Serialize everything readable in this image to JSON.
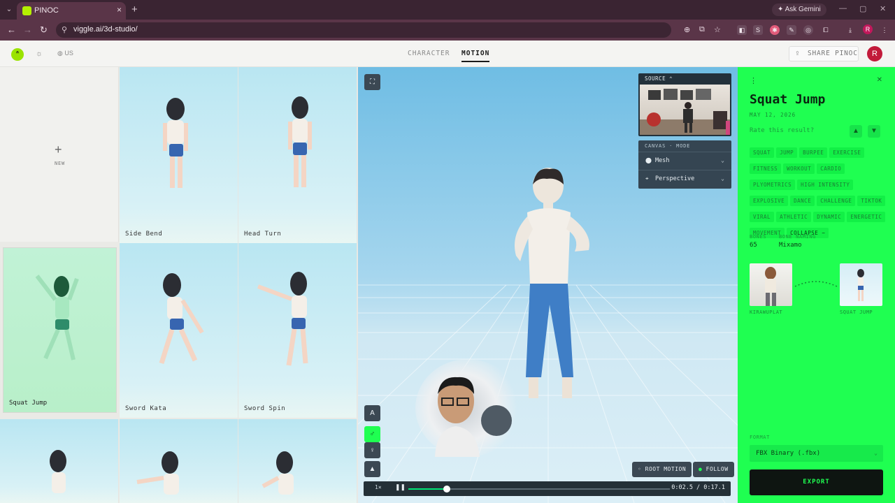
{
  "browser": {
    "tab_title": "PINOC",
    "url": "viggle.ai/3d-studio/",
    "ask_gemini": "Ask Gemini",
    "profile_initial": "R"
  },
  "header": {
    "region": "US",
    "tabs": [
      "CHARACTER",
      "MOTION"
    ],
    "active_tab": "MOTION",
    "share_label": "SHARE PINOC",
    "avatar_initial": "R",
    "logo_color": "#9be300"
  },
  "library": {
    "new_label": "NEW",
    "cards": [
      "Side Bend",
      "Head Turn",
      "Squat Jump",
      "Sword Kata",
      "Sword Spin"
    ],
    "selected": "Squat Jump"
  },
  "viewport": {
    "source_label": "SOURCE",
    "canvas_mode_label": "CANVAS · MODE",
    "render_mode": "Mesh",
    "camera_mode": "Perspective",
    "side_button": "A",
    "root_motion": "ROOT MOTION",
    "follow": "FOLLOW",
    "speed": "1×",
    "time": "0:02.5 / 0:17.1",
    "progress": 0.146
  },
  "panel": {
    "title": "Squat Jump",
    "date": "MAY 12, 2026",
    "rate_prompt": "Rate this result?",
    "tags": [
      "SQUAT",
      "JUMP",
      "BURPEE",
      "EXERCISE",
      "FITNESS",
      "WORKOUT",
      "CARDIO",
      "PLYOMETRICS",
      "HIGH INTENSITY",
      "EXPLOSIVE",
      "DANCE",
      "CHALLENGE",
      "TIKTOK",
      "VIRAL",
      "ATHLETIC",
      "DYNAMIC",
      "ENERGETIC",
      "MOVEMENT"
    ],
    "collapse_label": "COLLAPSE −",
    "bones_label": "BONES",
    "bones_value": "65",
    "naming_label": "BONE NAMING",
    "naming_value": "Mixamo",
    "from_label": "KIRAWUPLAT",
    "to_label": "SQUAT JUMP",
    "format_label": "FORMAT",
    "format_value": "FBX Binary (.fbx)",
    "export_label": "EXPORT",
    "accent_color": "#1fff51"
  }
}
